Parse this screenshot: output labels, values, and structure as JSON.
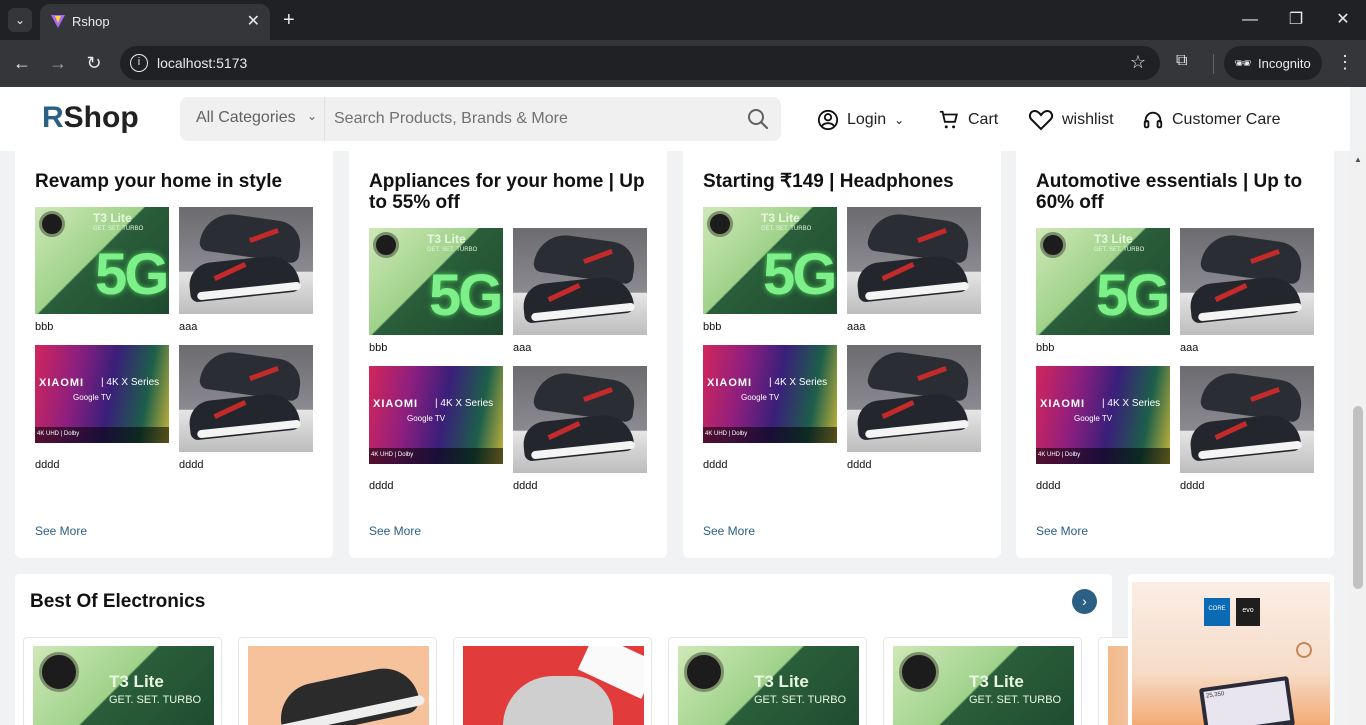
{
  "browser": {
    "tab_title": "Rshop",
    "url": "localhost:5173",
    "incognito_label": "Incognito"
  },
  "header": {
    "logo_r": "R",
    "logo_rest": "Shop",
    "category_select": "All Categories",
    "search_placeholder": "Search Products, Brands & More",
    "login": "Login",
    "cart": "Cart",
    "wishlist": "wishlist",
    "customer_care": "Customer Care"
  },
  "cards": [
    {
      "title": "Revamp your home in style",
      "products": [
        {
          "label": "bbb",
          "image": "phone"
        },
        {
          "label": "aaa",
          "image": "shoe"
        },
        {
          "label": "dddd",
          "image": "tv"
        },
        {
          "label": "dddd",
          "image": "shoe"
        }
      ],
      "see_more": "See More"
    },
    {
      "title": "Appliances for your home | Up to 55% off",
      "products": [
        {
          "label": "bbb",
          "image": "phone"
        },
        {
          "label": "aaa",
          "image": "shoe"
        },
        {
          "label": "dddd",
          "image": "tv"
        },
        {
          "label": "dddd",
          "image": "shoe"
        }
      ],
      "see_more": "See More"
    },
    {
      "title": "Starting ₹149 | Headphones",
      "products": [
        {
          "label": "bbb",
          "image": "phone"
        },
        {
          "label": "aaa",
          "image": "shoe"
        },
        {
          "label": "dddd",
          "image": "tv"
        },
        {
          "label": "dddd",
          "image": "shoe"
        }
      ],
      "see_more": "See More"
    },
    {
      "title": "Automotive essentials | Up to 60% off",
      "products": [
        {
          "label": "bbb",
          "image": "phone"
        },
        {
          "label": "aaa",
          "image": "shoe"
        },
        {
          "label": "dddd",
          "image": "tv"
        },
        {
          "label": "dddd",
          "image": "shoe"
        }
      ],
      "see_more": "See More"
    }
  ],
  "thumb_text": {
    "phone_model": "T3 Lite",
    "phone_brand": "vivo",
    "phone_tagline": "GET. SET. TURBO",
    "phone_5g": "5G",
    "tv_brand": "XIAOMI",
    "tv_series": "4K X Series",
    "tv_os": "Google TV",
    "tv_footer": "4K UHD | Dolby"
  },
  "best_of_electronics": {
    "title": "Best Of Electronics",
    "items": [
      {
        "image": "phone"
      },
      {
        "image": "sneaker"
      },
      {
        "image": "red-sneaker"
      },
      {
        "image": "phone"
      },
      {
        "image": "phone"
      }
    ]
  },
  "ad": {
    "badge_core": "CORE",
    "badge_evo": "evo",
    "screen_value": "25,350"
  },
  "colors": {
    "brand": "#2b5f84",
    "page_bg": "#f1f2f4"
  }
}
